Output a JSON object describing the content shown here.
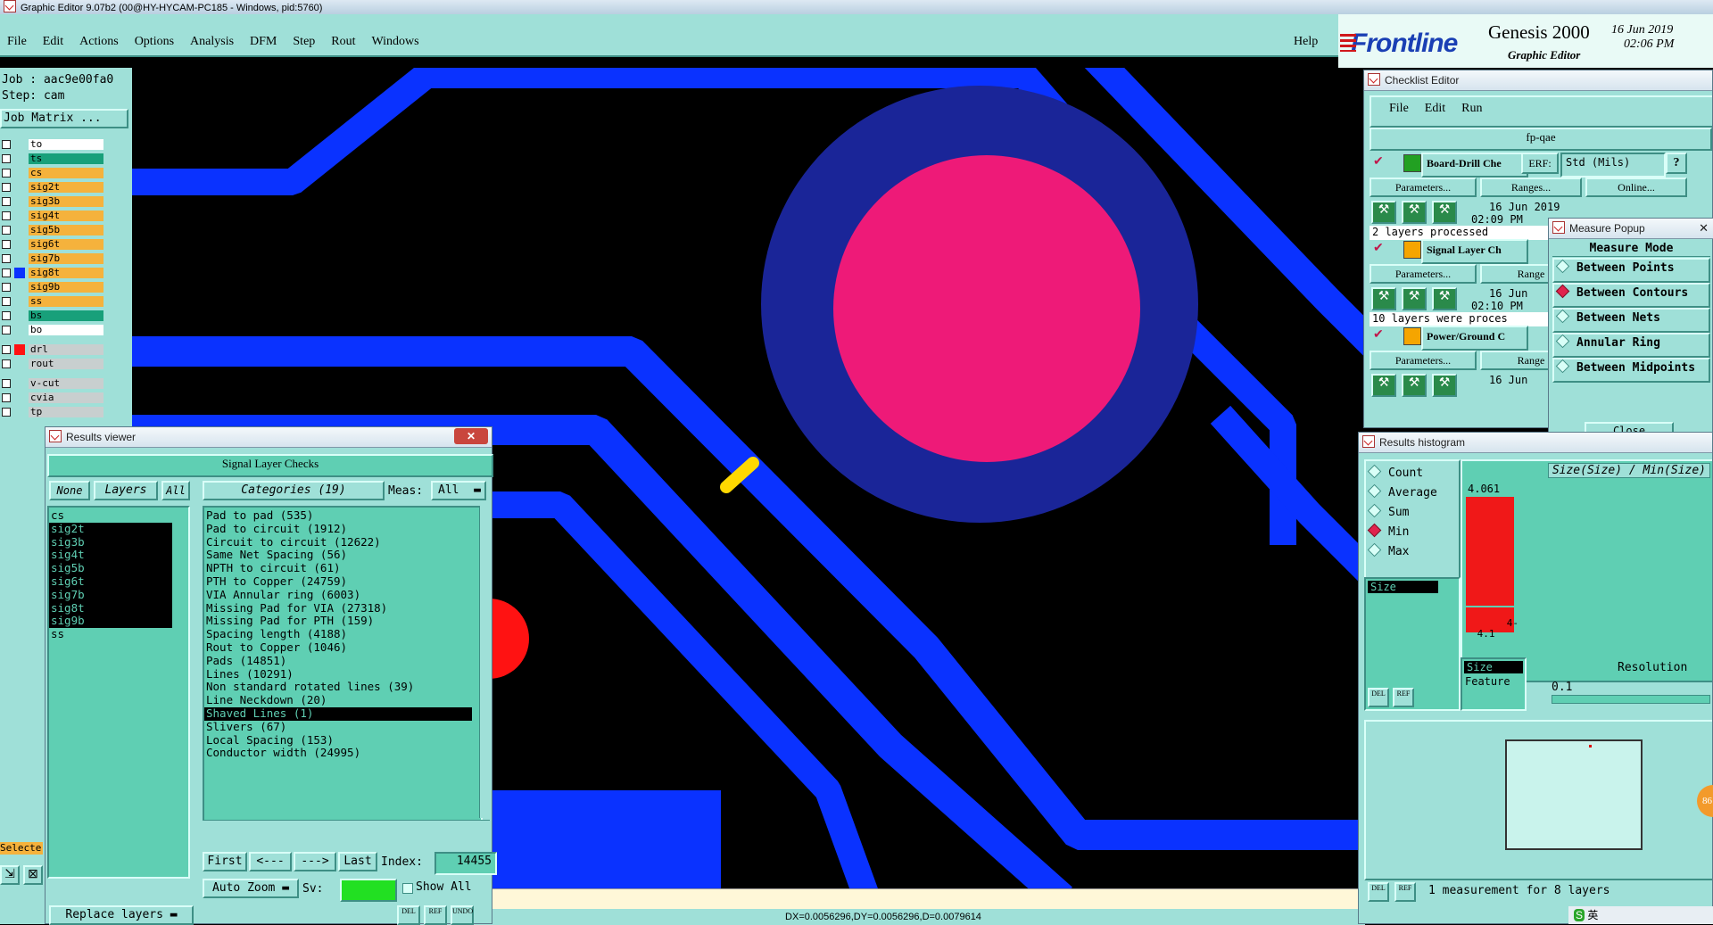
{
  "os_title": "Graphic Editor 9.07b2 (00@HY-HYCAM-PC185 - Windows, pid:5760)",
  "menu": [
    "File",
    "Edit",
    "Actions",
    "Options",
    "Analysis",
    "DFM",
    "Step",
    "Rout",
    "Windows"
  ],
  "help": "Help",
  "brand": {
    "logo": "Frontline",
    "product": "Genesis 2000",
    "subtitle": "Graphic Editor",
    "date": "16 Jun 2019",
    "time": "02:06 PM"
  },
  "job": {
    "job_line": "Job : aac9e00fa0",
    "step_line": "Step: cam",
    "matrix_button": "Job Matrix ..."
  },
  "layers": [
    {
      "name": "to",
      "color": "#ffffff"
    },
    {
      "name": "ts",
      "color": "#18a07a"
    },
    {
      "name": "cs",
      "color": "#f5b23c"
    },
    {
      "name": "sig2t",
      "color": "#f5b23c"
    },
    {
      "name": "sig3b",
      "color": "#f5b23c"
    },
    {
      "name": "sig4t",
      "color": "#f5b23c"
    },
    {
      "name": "sig5b",
      "color": "#f5b23c"
    },
    {
      "name": "sig6t",
      "color": "#f5b23c"
    },
    {
      "name": "sig7b",
      "color": "#f5b23c"
    },
    {
      "name": "sig8t",
      "color": "#f5b23c"
    },
    {
      "name": "sig9b",
      "color": "#f5b23c"
    },
    {
      "name": "ss",
      "color": "#f5b23c"
    },
    {
      "name": "bs",
      "color": "#18a07a"
    },
    {
      "name": "bo",
      "color": "#ffffff"
    },
    {
      "name": "drl",
      "color": "#c8cfcf"
    },
    {
      "name": "rout",
      "color": "#c8cfcf"
    },
    {
      "name": "v-cut",
      "color": "#c8cfcf"
    },
    {
      "name": "cvia",
      "color": "#c8cfcf"
    },
    {
      "name": "tp",
      "color": "#c8cfcf"
    }
  ],
  "left_bottom": {
    "selected_label": "Selecte"
  },
  "results_viewer": {
    "title": "Results viewer",
    "header": "Signal Layer Checks",
    "none_btn": "None",
    "layers_btn": "Layers",
    "all_btn": "All",
    "categories_btn": "Categories (19)",
    "meas_label": "Meas:",
    "meas_value": "All",
    "layer_list": [
      {
        "name": "cs",
        "sel": false
      },
      {
        "name": "sig2t",
        "sel": true
      },
      {
        "name": "sig3b",
        "sel": true
      },
      {
        "name": "sig4t",
        "sel": true
      },
      {
        "name": "sig5b",
        "sel": true
      },
      {
        "name": "sig6t",
        "sel": true
      },
      {
        "name": "sig7b",
        "sel": true
      },
      {
        "name": "sig8t",
        "sel": true
      },
      {
        "name": "sig9b",
        "sel": true
      },
      {
        "name": "ss",
        "sel": false
      }
    ],
    "categories": [
      {
        "text": "Pad to pad (535)",
        "sel": false
      },
      {
        "text": "Pad to circuit (1912)",
        "sel": false
      },
      {
        "text": "Circuit to circuit (12622)",
        "sel": false
      },
      {
        "text": "Same Net Spacing (56)",
        "sel": false
      },
      {
        "text": "NPTH to circuit (61)",
        "sel": false
      },
      {
        "text": "PTH to Copper (24759)",
        "sel": false
      },
      {
        "text": "VIA Annular ring (6003)",
        "sel": false
      },
      {
        "text": "Missing Pad for VIA (27318)",
        "sel": false
      },
      {
        "text": "Missing Pad for PTH (159)",
        "sel": false
      },
      {
        "text": "Spacing length (4188)",
        "sel": false
      },
      {
        "text": "Rout to Copper (1046)",
        "sel": false
      },
      {
        "text": "Pads (14851)",
        "sel": false
      },
      {
        "text": "Lines (10291)",
        "sel": false
      },
      {
        "text": "Non standard rotated lines (39)",
        "sel": false
      },
      {
        "text": "Line Neckdown (20)",
        "sel": false
      },
      {
        "text": "Shaved Lines (1)",
        "sel": true
      },
      {
        "text": "Slivers (67)",
        "sel": false
      },
      {
        "text": "Local Spacing (153)",
        "sel": false
      },
      {
        "text": "Conductor width (24995)",
        "sel": false
      }
    ],
    "first": "First",
    "prev": "<---",
    "next": "--->",
    "last": "Last",
    "index_label": "Index:",
    "index_value": "14455",
    "auto_zoom": "Auto Zoom",
    "sv_label": "Sv:",
    "show_all": "Show All",
    "replace_layers": "Replace layers"
  },
  "status_bar": "DX=0.0056296,DY=0.0056296,D=0.0079614",
  "checklist": {
    "title": "Checklist Editor",
    "menu": [
      "File",
      "Edit",
      "Run"
    ],
    "name": "fp-qae",
    "std_mils": "Std (Mils)",
    "erf": "ERF:",
    "help_q": "?",
    "items": [
      {
        "name": "Board-Drill Che",
        "date": "16 Jun 2019",
        "time": "02:09 PM",
        "status": "2 layers processed",
        "params": "Parameters...",
        "ranges": "Ranges...",
        "online": "Online..."
      },
      {
        "name": "Signal Layer Ch",
        "date": "16 Jun",
        "time": "02:10 PM",
        "status": "10 layers were proces",
        "params": "Parameters...",
        "ranges": "Range"
      },
      {
        "name": "Power/Ground C",
        "date": "16 Jun",
        "time": "",
        "status": "",
        "params": "Parameters...",
        "ranges": "Range"
      }
    ]
  },
  "measure_popup": {
    "title": "Measure Popup",
    "mode": "Measure Mode",
    "options": [
      {
        "label": "Between Points",
        "on": false
      },
      {
        "label": "Between Contours",
        "on": true
      },
      {
        "label": "Between Nets",
        "on": false
      },
      {
        "label": "Annular Ring",
        "on": false
      },
      {
        "label": "Between Midpoints",
        "on": false
      }
    ],
    "close": "Close"
  },
  "histogram": {
    "title": "Results histogram",
    "modes": [
      {
        "label": "Count",
        "on": false
      },
      {
        "label": "Average",
        "on": false
      },
      {
        "label": "Sum",
        "on": false
      },
      {
        "label": "Min",
        "on": true
      },
      {
        "label": "Max",
        "on": false
      }
    ],
    "size_label": "Size",
    "formula": "Size(Size) / Min(Size)",
    "bar_value": "4.061",
    "bar_range": "4-\n 4.1",
    "size_sel": "Size",
    "feature": "Feature",
    "resolution_label": "Resolution",
    "resolution_value": "0.1",
    "measurement_text": "1 measurement for 8 layers",
    "del": "DEL",
    "ref": "REF"
  },
  "tray": {
    "ime": "英",
    "badge": "86"
  }
}
